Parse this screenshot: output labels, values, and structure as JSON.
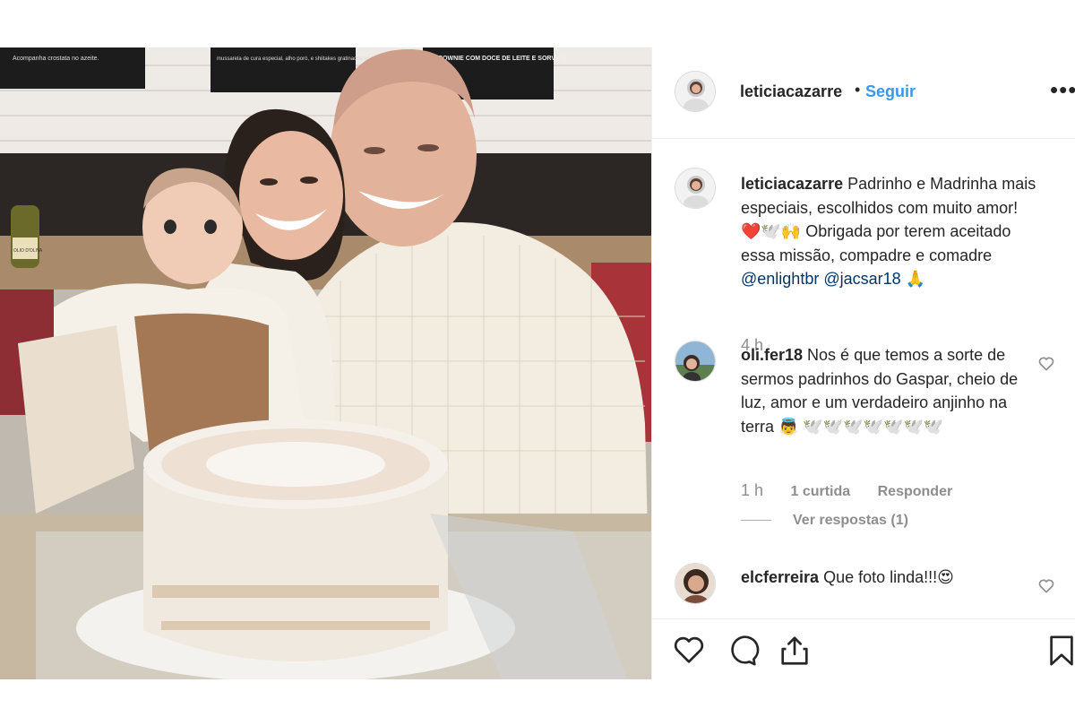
{
  "post": {
    "username": "leticiacazarre",
    "separator": "•",
    "follow_label": "Seguir",
    "more_label": "•••"
  },
  "photo": {
    "signs": [
      "Acompanha crostata no azeite.",
      "mussarela de cura especial, alho poró, e shiitakes gratinados em parmesão.",
      "BROWNIE COM DOCE DE LEITE E SORVETE"
    ],
    "bottle_label": "OLIO D'OLIVA"
  },
  "caption": {
    "username": "leticiacazarre",
    "text_part1": "Padrinho e Madrinha mais especiais, escolhidos com muito amor! ❤️🕊️🙌 Obrigada por terem aceitado essa missão, compadre e comadre",
    "mention1": "@enlightbr",
    "mention2": "@jacsar18",
    "emoji_end": "🙏",
    "time": "4 h"
  },
  "comments": [
    {
      "username": "oli.fer18",
      "text": "Nos é que temos a sorte de sermos padrinhos do Gaspar, cheio de luz, amor e um verdadeiro anjinho na terra 👼 🕊️🕊️🕊️🕊️🕊️🕊️🕊️",
      "time": "1 h",
      "likes": "1 curtida",
      "reply": "Responder",
      "view_replies": "Ver respostas (1)"
    },
    {
      "username": "elcferreira",
      "text": "Que foto linda!!!😍"
    }
  ],
  "colors": {
    "link": "#3897f0",
    "mention": "#003569",
    "muted": "#8e8e8e",
    "text": "#262626",
    "border": "#efefef"
  },
  "icons": [
    "heart-icon",
    "comment-icon",
    "share-icon",
    "bookmark-icon",
    "more-icon",
    "like-comment-icon"
  ]
}
